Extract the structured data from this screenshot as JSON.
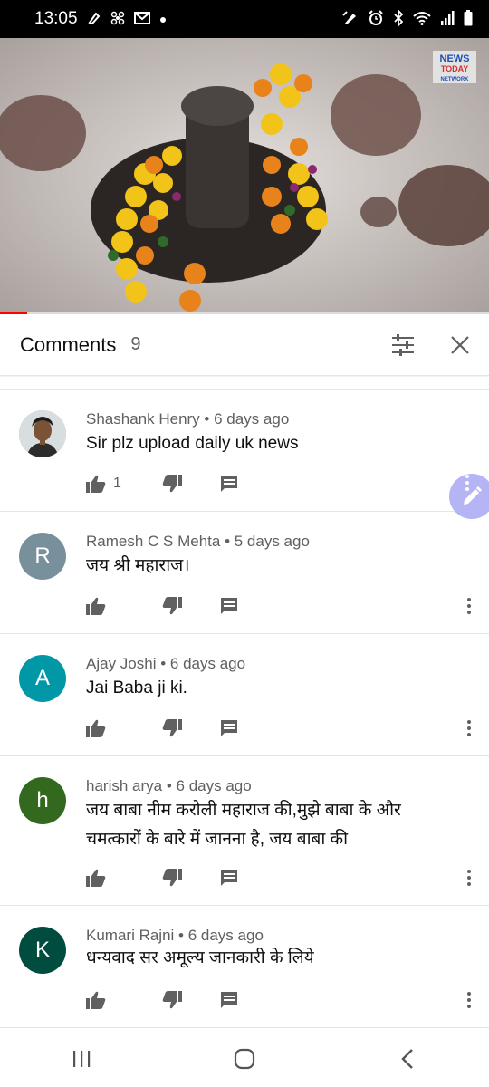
{
  "status_bar": {
    "time": "13:05",
    "left_icons": [
      "pen-icon",
      "pinwheel-icon",
      "mail-icon",
      "dot-icon"
    ],
    "right_icons": [
      "edit-icon",
      "alarm-icon",
      "bluetooth-icon",
      "wifi-icon",
      "signal-icon",
      "battery-icon"
    ]
  },
  "video": {
    "watermark_lines": [
      "NEWS",
      "TODAY",
      "NETWORK"
    ],
    "progress_fraction": 0.055
  },
  "comments_header": {
    "title": "Comments",
    "count": "9",
    "filter_icon": "sort-sliders-icon",
    "close_icon": "close-icon"
  },
  "comments": [
    {
      "author": "Shashank Henry",
      "age": "6 days ago",
      "text": "Sir plz upload daily uk news",
      "avatar_letter": "",
      "avatar_color": "#9aa5ad",
      "likes": "1"
    },
    {
      "author": "Ramesh C S Mehta",
      "age": "5 days ago",
      "text": "जय श्री महाराज।",
      "avatar_letter": "R",
      "avatar_color": "#78909c",
      "likes": ""
    },
    {
      "author": "Ajay Joshi",
      "age": "6 days ago",
      "text": "Jai Baba ji ki.",
      "avatar_letter": "A",
      "avatar_color": "#0097a7",
      "likes": ""
    },
    {
      "author": "harish arya",
      "age": "6 days ago",
      "text": "जय बाबा नीम करोली महाराज की,मुझे बाबा के और चमत्कारों के बारे में जानना है, जय बाबा की",
      "avatar_letter": "h",
      "avatar_color": "#33691e",
      "likes": ""
    },
    {
      "author": "Kumari Rajni",
      "age": "6 days ago",
      "text": "धन्यवाद सर अमूल्य जानकारी के लिये",
      "avatar_letter": "K",
      "avatar_color": "#004d40",
      "likes": ""
    }
  ],
  "separator": " • ",
  "fab": {
    "icon": "pencil-icon",
    "color": "#b5b5f5"
  },
  "nav_bar": {
    "icons": [
      "recent-apps-icon",
      "home-icon",
      "back-icon"
    ]
  }
}
